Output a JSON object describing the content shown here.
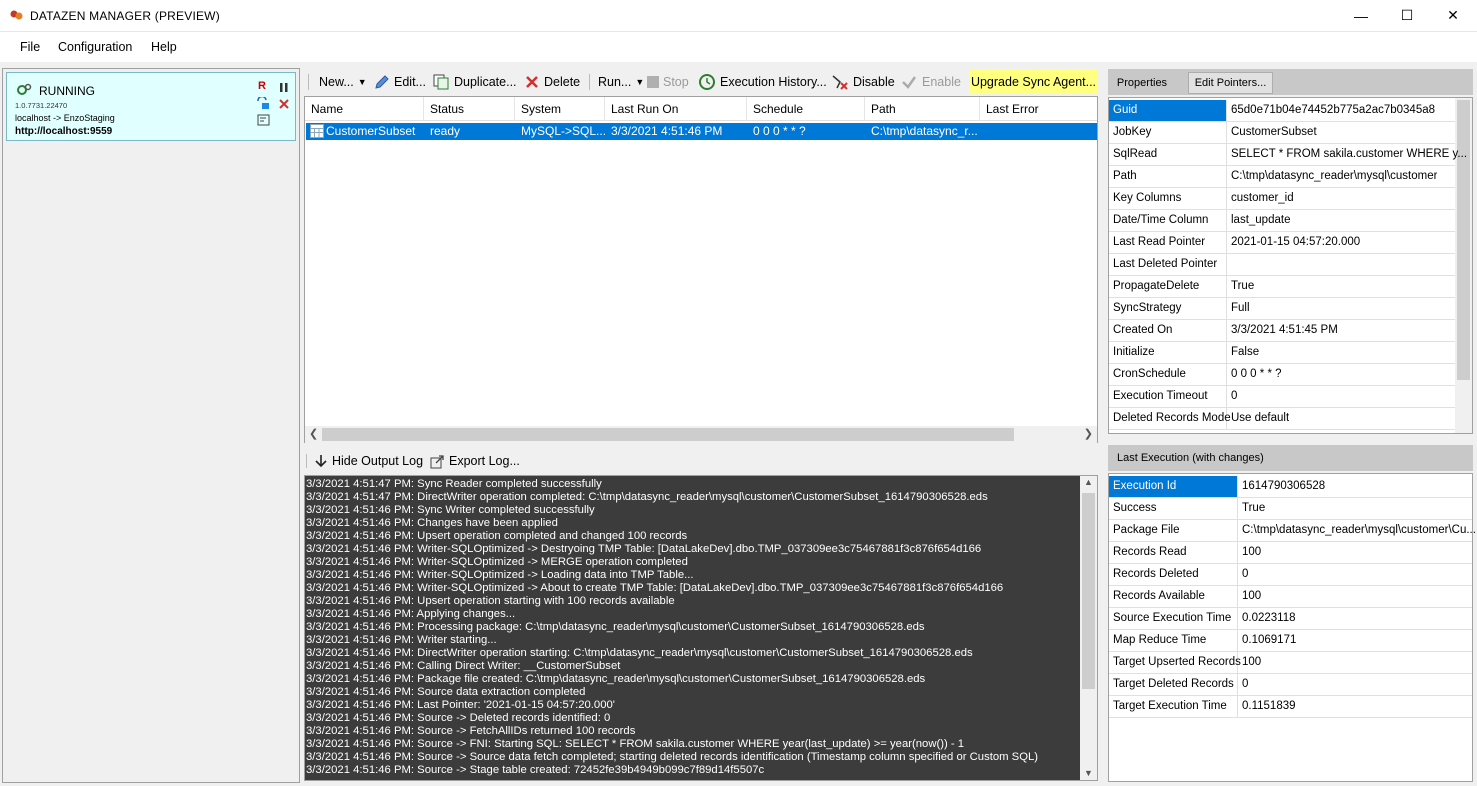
{
  "window": {
    "title": "DATAZEN MANAGER  (PREVIEW)",
    "minimize": "—",
    "maximize": "☐",
    "close": "✕"
  },
  "menu": [
    "File",
    "Configuration",
    "Help"
  ],
  "agent": {
    "state": "RUNNING",
    "version": "1.0.7731.22470",
    "connection": "localhost -> EnzoStaging",
    "url": "http://localhost:9559",
    "r_label": "R"
  },
  "toolbar": {
    "new": "New...",
    "edit": "Edit...",
    "duplicate": "Duplicate...",
    "delete": "Delete",
    "run": "Run...",
    "stop": "Stop",
    "history": "Execution History...",
    "disable": "Disable",
    "enable": "Enable",
    "upgrade": "Upgrade Sync Agent..."
  },
  "jobs": {
    "columns": [
      "Name",
      "Status",
      "System",
      "Last Run On",
      "Schedule",
      "Path",
      "Last Error"
    ],
    "rows": [
      {
        "name": "CustomerSubset",
        "status": "ready",
        "system": "MySQL->SQL...",
        "last_run": "3/3/2021 4:51:46 PM",
        "schedule": "0 0 0 * * ?",
        "path": "C:\\tmp\\datasync_r...",
        "last_error": ""
      }
    ]
  },
  "logbar": {
    "hide": "Hide Output Log",
    "export": "Export Log..."
  },
  "log": [
    "3/3/2021 4:51:47 PM: Sync Reader completed successfully",
    "3/3/2021 4:51:47 PM:  DirectWriter operation completed: C:\\tmp\\datasync_reader\\mysql\\customer\\CustomerSubset_1614790306528.eds",
    "3/3/2021 4:51:46 PM: Sync Writer completed successfully",
    "3/3/2021 4:51:46 PM: Changes have been applied",
    "3/3/2021 4:51:46 PM: Upsert operation completed and changed 100 records",
    "3/3/2021 4:51:46 PM: Writer-SQLOptimized -> Destryoing TMP Table: [DataLakeDev].dbo.TMP_037309ee3c75467881f3c876f654d166",
    "3/3/2021 4:51:46 PM: Writer-SQLOptimized -> MERGE operation completed",
    "3/3/2021 4:51:46 PM: Writer-SQLOptimized -> Loading data into TMP Table...",
    "3/3/2021 4:51:46 PM: Writer-SQLOptimized -> About to create TMP Table: [DataLakeDev].dbo.TMP_037309ee3c75467881f3c876f654d166",
    "3/3/2021 4:51:46 PM: Upsert operation starting with 100 records available",
    "3/3/2021 4:51:46 PM: Applying changes...",
    "3/3/2021 4:51:46 PM: Processing package: C:\\tmp\\datasync_reader\\mysql\\customer\\CustomerSubset_1614790306528.eds",
    "3/3/2021 4:51:46 PM: Writer starting...",
    "3/3/2021 4:51:46 PM:  DirectWriter operation starting: C:\\tmp\\datasync_reader\\mysql\\customer\\CustomerSubset_1614790306528.eds",
    "3/3/2021 4:51:46 PM: Calling Direct Writer: __CustomerSubset",
    "3/3/2021 4:51:46 PM: Package file created: C:\\tmp\\datasync_reader\\mysql\\customer\\CustomerSubset_1614790306528.eds",
    "3/3/2021 4:51:46 PM: Source data extraction completed",
    "3/3/2021 4:51:46 PM: Last Pointer: '2021-01-15 04:57:20.000'",
    "3/3/2021 4:51:46 PM: Source -> Deleted records identified: 0",
    "3/3/2021 4:51:46 PM: Source -> FetchAllIDs returned 100 records",
    "3/3/2021 4:51:46 PM: Source -> FNI: Starting SQL: SELECT * FROM sakila.customer WHERE year(last_update) >= year(now()) - 1",
    "3/3/2021 4:51:46 PM: Source -> Source data fetch completed; starting deleted records identification (Timestamp column specified or Custom SQL)",
    "3/3/2021 4:51:46 PM: Source -> Stage table created: 72452fe39b4949b099c7f89d14f5507c"
  ],
  "props_tabs": {
    "properties": "Properties",
    "edit_pointers": "Edit Pointers..."
  },
  "properties": [
    {
      "k": "Guid",
      "v": "65d0e71b04e74452b775a2ac7b0345a8"
    },
    {
      "k": "JobKey",
      "v": "CustomerSubset"
    },
    {
      "k": "SqlRead",
      "v": "SELECT * FROM sakila.customer WHERE y..."
    },
    {
      "k": "Path",
      "v": "C:\\tmp\\datasync_reader\\mysql\\customer"
    },
    {
      "k": "Key Columns",
      "v": "customer_id"
    },
    {
      "k": "Date/Time Column",
      "v": "last_update"
    },
    {
      "k": "Last Read Pointer",
      "v": "2021-01-15 04:57:20.000"
    },
    {
      "k": "Last Deleted Pointer",
      "v": ""
    },
    {
      "k": "PropagateDelete",
      "v": "True"
    },
    {
      "k": "SyncStrategy",
      "v": "Full"
    },
    {
      "k": "Created On",
      "v": "3/3/2021 4:51:45 PM"
    },
    {
      "k": "Initialize",
      "v": "False"
    },
    {
      "k": "CronSchedule",
      "v": "0 0 0 * * ?"
    },
    {
      "k": "Execution Timeout",
      "v": "0"
    },
    {
      "k": "Deleted Records Mode",
      "v": "Use default"
    }
  ],
  "exec_header": "Last Execution (with changes)",
  "execution": [
    {
      "k": "Execution Id",
      "v": "1614790306528"
    },
    {
      "k": "Success",
      "v": "True"
    },
    {
      "k": "Package File",
      "v": "C:\\tmp\\datasync_reader\\mysql\\customer\\Cu..."
    },
    {
      "k": "Records Read",
      "v": "100"
    },
    {
      "k": "Records Deleted",
      "v": "0"
    },
    {
      "k": "Records Available",
      "v": "100"
    },
    {
      "k": "Source Execution Time",
      "v": "0.0223118"
    },
    {
      "k": "Map Reduce Time",
      "v": "0.1069171"
    },
    {
      "k": "Target Upserted Records",
      "v": "100"
    },
    {
      "k": "Target Deleted Records",
      "v": "0"
    },
    {
      "k": "Target Execution Time",
      "v": "0.1151839"
    }
  ],
  "colors": {
    "selection": "#0078d7",
    "agent_bg": "#e0ffff",
    "log_bg": "#3c3c3c",
    "upgrade_bg": "#ffff80"
  }
}
